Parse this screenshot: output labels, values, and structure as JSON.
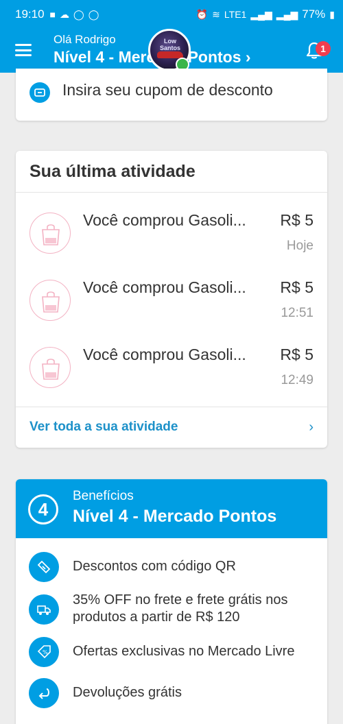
{
  "status_bar": {
    "time": "19:10",
    "battery": "77%",
    "network": "LTE1",
    "notification_icons": [
      "chat-icon",
      "weather-icon",
      "whatsapp-icon",
      "whatsapp-icon"
    ],
    "system_icons": [
      "alarm-icon",
      "wifi-icon",
      "signal-icon",
      "signal-icon",
      "battery-icon"
    ]
  },
  "header": {
    "greeting": "Olá Rodrigo",
    "level_text": "Nível 4 - Mercado Pontos ›",
    "notification_count": "1",
    "avatar_text": "Low Santos"
  },
  "coupon": {
    "label": "Insira seu cupom de desconto"
  },
  "activity": {
    "title": "Sua última atividade",
    "items": [
      {
        "description": "Você comprou Gasoli...",
        "amount": "R$ 5",
        "time": "Hoje"
      },
      {
        "description": "Você comprou Gasoli...",
        "amount": "R$ 5",
        "time": "12:51"
      },
      {
        "description": "Você comprou Gasoli...",
        "amount": "R$ 5",
        "time": "12:49"
      }
    ],
    "see_all": "Ver toda a sua atividade"
  },
  "benefits": {
    "level_number": "4",
    "label": "Benefícios",
    "level_name": "Nível 4 - Mercado Pontos",
    "items": [
      {
        "icon": "qr-discount-icon",
        "text": "Descontos com código QR"
      },
      {
        "icon": "truck-icon",
        "text": "35% OFF no frete e frete grátis nos produtos a partir de R$ 120"
      },
      {
        "icon": "discount-tag-icon",
        "text": "Ofertas exclusivas no Mercado Livre"
      },
      {
        "icon": "return-arrow-icon",
        "text": "Devoluções grátis"
      }
    ]
  },
  "colors": {
    "brand_blue": "#009ee3",
    "link_blue": "#1d91c9",
    "badge_red": "#f23d4f",
    "activity_pink": "#f3b2c3"
  }
}
